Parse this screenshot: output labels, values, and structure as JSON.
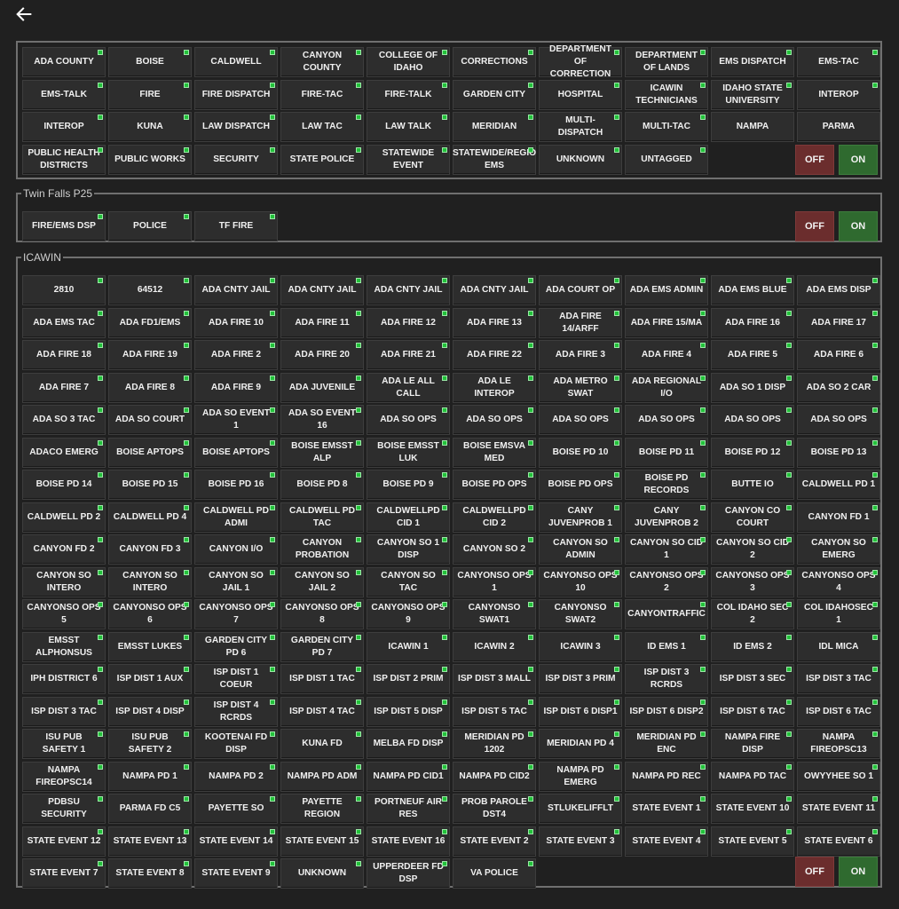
{
  "nav": {
    "back_icon": "arrow-left-icon"
  },
  "colors": {
    "led": "#22c23a",
    "off": "#6b2d2d",
    "on": "#2f6a2f",
    "tile": "#2d2d2d"
  },
  "groups": [
    {
      "legend": "",
      "off_label": "OFF",
      "on_label": "ON",
      "talkgroups": [
        "ADA COUNTY",
        "BOISE",
        "CALDWELL",
        "CANYON COUNTY",
        "COLLEGE OF IDAHO",
        "CORRECTIONS",
        "DEPARTMENT OF CORRECTION",
        "DEPARTMENT OF LANDS",
        "EMS DISPATCH",
        "EMS-TAC",
        "EMS-TALK",
        "FIRE",
        "FIRE DISPATCH",
        "FIRE-TAC",
        "FIRE-TALK",
        "GARDEN CITY",
        "HOSPITAL",
        "ICAWIN TECHNICIANS",
        "IDAHO STATE UNIVERSITY",
        "INTEROP",
        "INTEROP",
        "KUNA",
        "LAW DISPATCH",
        "LAW TAC",
        "LAW TALK",
        "MERIDIAN",
        "MULTI-DISPATCH",
        "MULTI-TAC",
        "NAMPA",
        "PARMA",
        "PUBLIC HEALTH DISTRICTS",
        "PUBLIC WORKS",
        "SECURITY",
        "STATE POLICE",
        "STATEWIDE EVENT",
        "STATEWIDE/REGIO EMS",
        "UNKNOWN",
        "UNTAGGED"
      ],
      "no_led": [
        28,
        29
      ]
    },
    {
      "legend": "Twin Falls P25",
      "off_label": "OFF",
      "on_label": "ON",
      "talkgroups": [
        "FIRE/EMS DSP",
        "POLICE",
        "TF FIRE"
      ],
      "no_led": []
    },
    {
      "legend": "ICAWIN",
      "off_label": "OFF",
      "on_label": "ON",
      "talkgroups": [
        "2810",
        "64512",
        "ADA CNTY JAIL",
        "ADA CNTY JAIL",
        "ADA CNTY JAIL",
        "ADA CNTY JAIL",
        "ADA COURT OP",
        "ADA EMS ADMIN",
        "ADA EMS BLUE",
        "ADA EMS DISP",
        "ADA EMS TAC",
        "ADA FD1/EMS",
        "ADA FIRE 10",
        "ADA FIRE 11",
        "ADA FIRE 12",
        "ADA FIRE 13",
        "ADA FIRE 14/ARFF",
        "ADA FIRE 15/MA",
        "ADA FIRE 16",
        "ADA FIRE 17",
        "ADA FIRE 18",
        "ADA FIRE 19",
        "ADA FIRE 2",
        "ADA FIRE 20",
        "ADA FIRE 21",
        "ADA FIRE 22",
        "ADA FIRE 3",
        "ADA FIRE 4",
        "ADA FIRE 5",
        "ADA FIRE 6",
        "ADA FIRE 7",
        "ADA FIRE 8",
        "ADA FIRE 9",
        "ADA JUVENILE",
        "ADA LE ALL CALL",
        "ADA LE INTEROP",
        "ADA METRO SWAT",
        "ADA REGIONAL I/O",
        "ADA SO 1 DISP",
        "ADA SO 2 CAR",
        "ADA SO 3 TAC",
        "ADA SO COURT",
        "ADA SO EVENT 1",
        "ADA SO EVENT 16",
        "ADA SO OPS",
        "ADA SO OPS",
        "ADA SO OPS",
        "ADA SO OPS",
        "ADA SO OPS",
        "ADA SO OPS",
        "ADACO EMERG",
        "BOISE APTOPS",
        "BOISE APTOPS",
        "BOISE EMSST ALP",
        "BOISE EMSST LUK",
        "BOISE EMSVA MED",
        "BOISE PD 10",
        "BOISE PD 11",
        "BOISE PD 12",
        "BOISE PD 13",
        "BOISE PD 14",
        "BOISE PD 15",
        "BOISE PD 16",
        "BOISE PD 8",
        "BOISE PD 9",
        "BOISE PD OPS",
        "BOISE PD OPS",
        "BOISE PD RECORDS",
        "BUTTE IO",
        "CALDWELL PD 1",
        "CALDWELL PD 2",
        "CALDWELL PD 4",
        "CALDWELL PD ADMI",
        "CALDWELL PD TAC",
        "CALDWELLPD CID 1",
        "CALDWELLPD CID 2",
        "CANY JUVENPROB 1",
        "CANY JUVENPROB 2",
        "CANYON CO COURT",
        "CANYON FD 1",
        "CANYON FD 2",
        "CANYON FD 3",
        "CANYON I/O",
        "CANYON PROBATION",
        "CANYON SO 1 DISP",
        "CANYON SO 2",
        "CANYON SO ADMIN",
        "CANYON SO CID 1",
        "CANYON SO CID 2",
        "CANYON SO EMERG",
        "CANYON SO INTERO",
        "CANYON SO INTERO",
        "CANYON SO JAIL 1",
        "CANYON SO JAIL 2",
        "CANYON SO TAC",
        "CANYONSO OPS 1",
        "CANYONSO OPS 10",
        "CANYONSO OPS 2",
        "CANYONSO OPS 3",
        "CANYONSO OPS 4",
        "CANYONSO OPS 5",
        "CANYONSO OPS 6",
        "CANYONSO OPS 7",
        "CANYONSO OPS 8",
        "CANYONSO OPS 9",
        "CANYONSO SWAT1",
        "CANYONSO SWAT2",
        "CANYONTRAFFIC",
        "COL IDAHO SEC 2",
        "COL IDAHOSEC 1",
        "EMSST ALPHONSUS",
        "EMSST LUKES",
        "GARDEN CITY PD 6",
        "GARDEN CITY PD 7",
        "ICAWIN 1",
        "ICAWIN 2",
        "ICAWIN 3",
        "ID EMS 1",
        "ID EMS 2",
        "IDL MICA",
        "IPH DISTRICT 6",
        "ISP DIST 1 AUX",
        "ISP DIST 1 COEUR",
        "ISP DIST 1 TAC",
        "ISP DIST 2 PRIM",
        "ISP DIST 3 MALL",
        "ISP DIST 3 PRIM",
        "ISP DIST 3 RCRDS",
        "ISP DIST 3 SEC",
        "ISP DIST 3 TAC",
        "ISP DIST 3 TAC",
        "ISP DIST 4 DISP",
        "ISP DIST 4 RCRDS",
        "ISP DIST 4 TAC",
        "ISP DIST 5 DISP",
        "ISP DIST 5 TAC",
        "ISP DIST 6 DISP1",
        "ISP DIST 6 DISP2",
        "ISP DIST 6 TAC",
        "ISP DIST 6 TAC",
        "ISU PUB SAFETY 1",
        "ISU PUB SAFETY 2",
        "KOOTENAI FD DISP",
        "KUNA FD",
        "MELBA FD DISP",
        "MERIDIAN PD 1202",
        "MERIDIAN PD 4",
        "MERIDIAN PD ENC",
        "NAMPA FIRE DISP",
        "NAMPA FIREOPSC13",
        "NAMPA FIREOPSC14",
        "NAMPA PD 1",
        "NAMPA PD 2",
        "NAMPA PD ADM",
        "NAMPA PD CID1",
        "NAMPA PD CID2",
        "NAMPA PD EMERG",
        "NAMPA PD REC",
        "NAMPA PD TAC",
        "OWYYHEE SO 1",
        "PDBSU SECURITY",
        "PARMA FD C5",
        "PAYETTE SO",
        "PAYETTE REGION",
        "PORTNEUF AIR RES",
        "PROB PAROLE DST4",
        "STLUKELIFFLT",
        "STATE EVENT 1",
        "STATE EVENT 10",
        "STATE EVENT 11",
        "STATE EVENT 12",
        "STATE EVENT 13",
        "STATE EVENT 14",
        "STATE EVENT 15",
        "STATE EVENT 16",
        "STATE EVENT 2",
        "STATE EVENT 3",
        "STATE EVENT 4",
        "STATE EVENT 5",
        "STATE EVENT 6",
        "STATE EVENT 7",
        "STATE EVENT 8",
        "STATE EVENT 9",
        "UNKNOWN",
        "UPPERDEER FD DSP",
        "VA POLICE"
      ],
      "no_led": []
    }
  ]
}
